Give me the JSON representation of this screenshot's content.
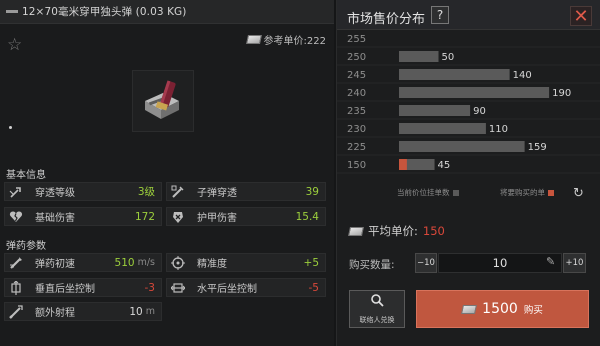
{
  "item": {
    "name": "12×70毫米穿甲独头弹 (0.03 KG)",
    "reference_price_label": "参考单价:222"
  },
  "basic_info": {
    "title": "基本信息",
    "stats": [
      {
        "label": "穿透等级",
        "value": "3级",
        "color": "#9ccf3c",
        "icon": "penetration-icon"
      },
      {
        "label": "子弹穿透",
        "value": "39",
        "color": "#9ccf3c",
        "icon": "bullet-penetration-icon"
      },
      {
        "label": "基础伤害",
        "value": "172",
        "color": "#9ccf3c",
        "icon": "broken-heart-icon"
      },
      {
        "label": "护甲伤害",
        "value": "15.4",
        "color": "#9ccf3c",
        "icon": "armor-damage-icon"
      }
    ]
  },
  "ammo_params": {
    "title": "弹药参数",
    "stats": [
      {
        "label": "弹药初速",
        "value": "510",
        "unit": "m/s",
        "color": "#9ccf3c",
        "icon": "muzzle-velocity-icon"
      },
      {
        "label": "精准度",
        "value": "+5",
        "color": "#9ccf3c",
        "icon": "crosshair-icon"
      },
      {
        "label": "垂直后坐控制",
        "value": "-3",
        "color": "#d9483a",
        "icon": "vertical-recoil-icon"
      },
      {
        "label": "水平后坐控制",
        "value": "-5",
        "color": "#d9483a",
        "icon": "horizontal-recoil-icon"
      },
      {
        "label": "额外射程",
        "value": "10",
        "unit": "m",
        "color": "#d8d8d8",
        "icon": "range-icon"
      }
    ]
  },
  "market": {
    "title": "市场售价分布",
    "help_label": "?",
    "legend_current": "当前价位挂单数",
    "legend_buy": "将要购买的单",
    "avg_price_label": "平均单价:",
    "avg_price_value": "150",
    "quantity_label": "购买数量:",
    "minus_label": "−10",
    "plus_label": "+10",
    "quantity_value": "10",
    "contact_label": "联络人兑换",
    "buy_price": "1500",
    "buy_label": "购买"
  },
  "chart_data": {
    "type": "bar",
    "orientation": "horizontal",
    "title": "市场售价分布",
    "categories": [
      "255",
      "250",
      "245",
      "240",
      "235",
      "230",
      "225",
      "150"
    ],
    "series": [
      {
        "name": "当前价位挂单数",
        "values": [
          null,
          50,
          140,
          190,
          90,
          110,
          159,
          45
        ],
        "color": "#5a5a5a"
      },
      {
        "name": "将要购买的单",
        "values": [
          null,
          0,
          0,
          0,
          0,
          0,
          0,
          10
        ],
        "color": "#c8553d"
      }
    ],
    "data_labels": [
      "",
      "50",
      "140",
      "190",
      "90",
      "110",
      "159",
      "45"
    ],
    "xlim": [
      0,
      200
    ],
    "grid": false,
    "legend": "bottom"
  },
  "colors": {
    "positive": "#9ccf3c",
    "negative": "#d9483a",
    "accent": "#c0573f",
    "bar": "#5a5a5a",
    "buy_bar": "#c8553d"
  }
}
